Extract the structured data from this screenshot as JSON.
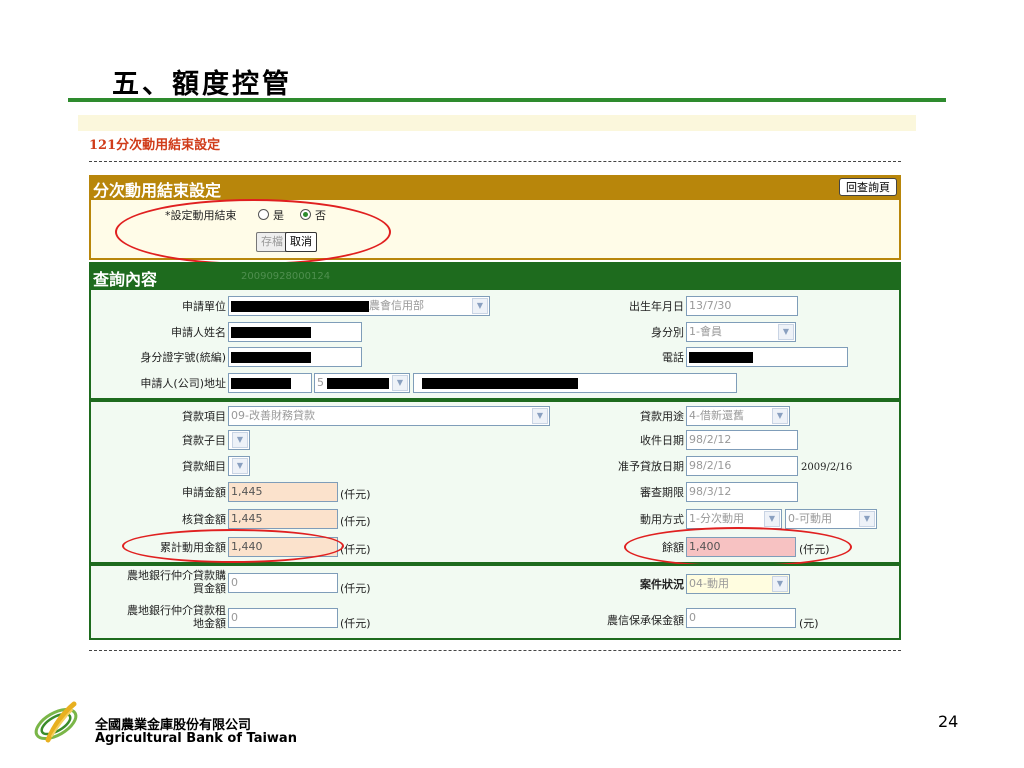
{
  "slide": {
    "title": "五、額度控管",
    "page_number": "24"
  },
  "page": {
    "header": "121分次動用結束設定"
  },
  "setting": {
    "title": "分次動用結束設定",
    "back_button": "回查詢頁",
    "label": "*設定動用結束",
    "option_yes": "是",
    "option_no": "否",
    "selected": "否",
    "save_button": "存檔",
    "cancel_button": "取消"
  },
  "query": {
    "title": "查詢內容",
    "case_id": "20090928000124",
    "applicant": {
      "unit_label": "申請單位",
      "unit_value_suffix": "農會信用部",
      "name_label": "申請人姓名",
      "id_label": "身分證字號(統編)",
      "address_label": "申請人(公司)地址",
      "address_part2_prefix": "5",
      "birth_label": "出生年月日",
      "birth_value": "13/7/30",
      "identity_label": "身分別",
      "identity_value": "1-會員",
      "phone_label": "電話"
    },
    "loan": {
      "item_label": "貸款項目",
      "item_value": "09-改善財務貸款",
      "subitem_label": "貸款子目",
      "detail_label": "貸款細目",
      "apply_amount_label": "申請金額",
      "apply_amount": "1,445",
      "approved_amount_label": "核貸金額",
      "approved_amount": "1,445",
      "cumulative_label": "累計動用金額",
      "cumulative_amount": "1,440",
      "unit_thousand": "(仟元)",
      "purpose_label": "貸款用途",
      "purpose_value": "4-借新還舊",
      "receive_date_label": "收件日期",
      "receive_date": "98/2/12",
      "approve_date_label": "准予貸放日期",
      "approve_date": "98/2/16",
      "approve_date_ad": "2009/2/16",
      "review_label": "審查期限",
      "review_date": "98/3/12",
      "usage_label": "動用方式",
      "usage_value": "1-分次動用",
      "usage_status": "0-可動用",
      "balance_label": "餘額",
      "balance_value": "1,400"
    },
    "extra": {
      "land_buy_label_1": "農地銀行仲介貸款購",
      "land_buy_label_2": "買金額",
      "land_buy_value": "0",
      "land_rent_label_1": "農地銀行仲介貸款租",
      "land_rent_label_2": "地金額",
      "land_rent_value": "0",
      "case_status_label": "案件狀況",
      "case_status_value": "04-動用",
      "guarantee_label": "農信保承保金額",
      "guarantee_value": "0",
      "unit_yuan": "(元)"
    }
  },
  "footer": {
    "company_cn": "全國農業金庫股份有限公司",
    "company_en": "Agricultural Bank of Taiwan"
  },
  "colors": {
    "title_rule": "#2e8b2e",
    "setting_header": "#b8860b",
    "query_header": "#1e6b1e",
    "header_text": "#d03c1a",
    "annotation": "#e02020"
  }
}
